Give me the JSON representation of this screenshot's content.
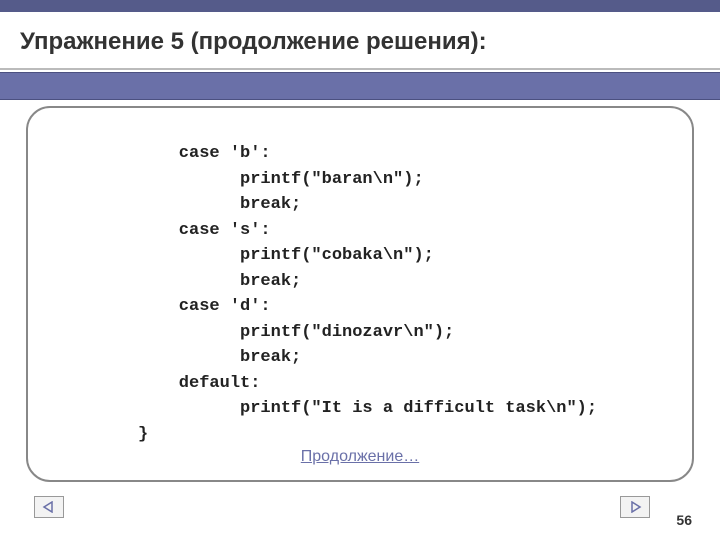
{
  "title": "Упражнение 5 (продолжение решения):",
  "code": "    case 'b':\n          printf(\"baran\\n\");\n          break;\n    case 's':\n          printf(\"cobaka\\n\");\n          break;\n    case 'd':\n          printf(\"dinozavr\\n\");\n          break;\n    default:\n          printf(\"It is a difficult task\\n\");\n}",
  "continue_label": "Продолжение…",
  "page_number": "56"
}
